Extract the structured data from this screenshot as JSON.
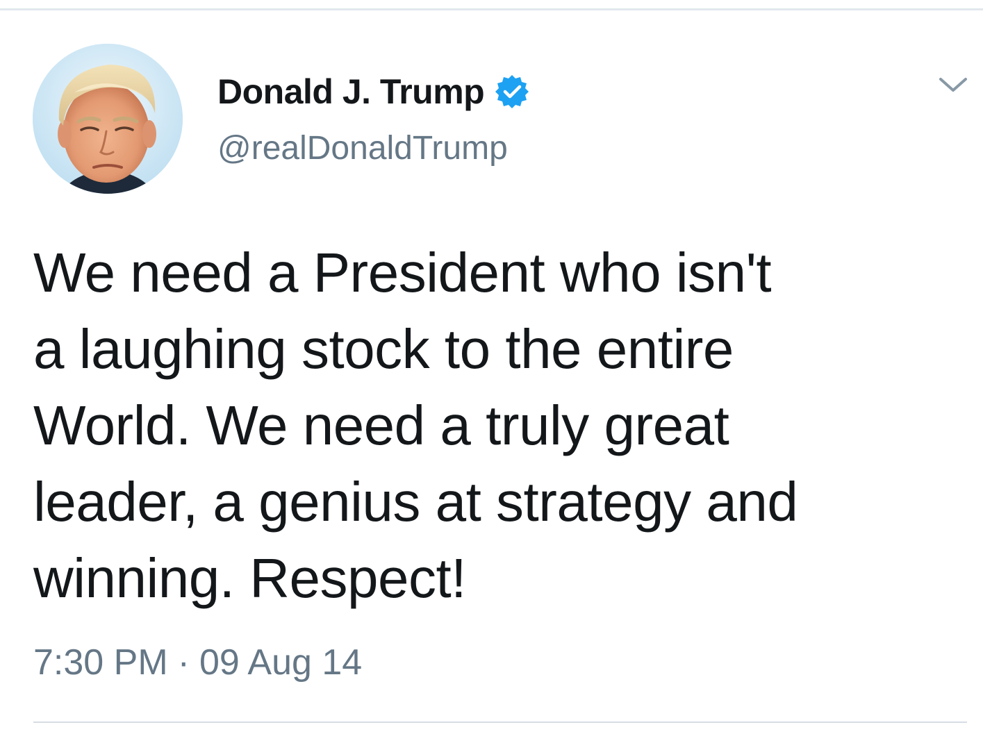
{
  "tweet": {
    "author": {
      "display_name": "Donald J. Trump",
      "handle": "@realDonaldTrump",
      "verified": true,
      "avatar_icon": "profile-photo"
    },
    "text_lines": [
      "We need a President who isn't",
      "a laughing stock to the entire",
      "World. We need a truly great",
      "leader, a genius at strategy and",
      "winning. Respect!"
    ],
    "time": "7:30 PM",
    "separator": "·",
    "date": "09 Aug 14"
  },
  "icons": {
    "verified": "verified-badge-icon",
    "menu": "chevron-down-icon"
  },
  "colors": {
    "text_primary": "#14171a",
    "text_secondary": "#657786",
    "verified_blue": "#1da1f2",
    "divider": "#e1e8ed"
  }
}
